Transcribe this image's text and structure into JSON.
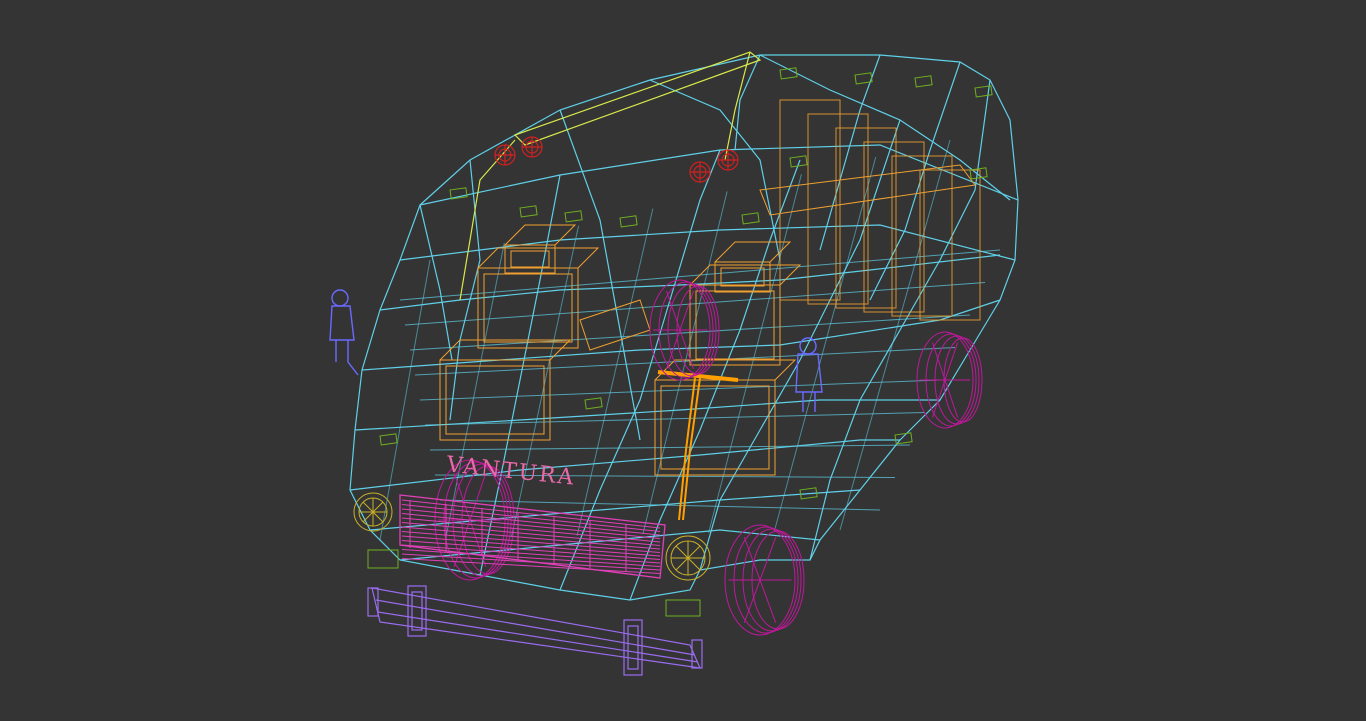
{
  "viewport": {
    "background": "#343434",
    "model_badge": "VANTURA"
  },
  "colors": {
    "body": "#5fd0e8",
    "seats": "#f0a030",
    "wheels": "#c0189c",
    "bumper": "#9b6cf0",
    "lights": "#c8b02a",
    "grille": "#e040b8",
    "details_green": "#6fb020",
    "mirrors_red": "#d22020",
    "figure_blue": "#6a6aff",
    "roof_rack": "#d8e84a",
    "badge": "#e86aa8",
    "steering": "#ffa000"
  },
  "icons": {
    "figure_left": "person-figure-icon",
    "figure_right": "person-figure-icon"
  }
}
